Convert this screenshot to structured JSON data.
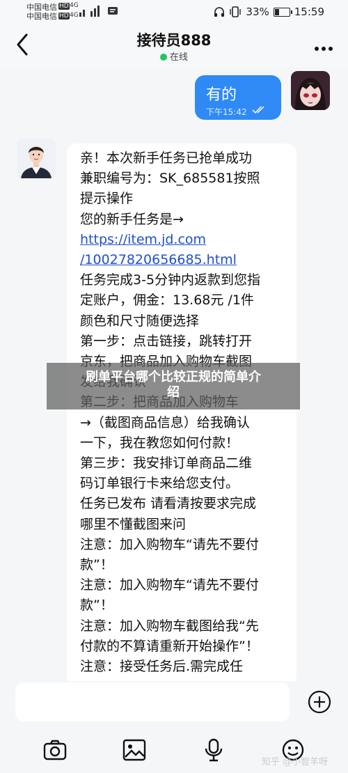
{
  "status_bar": {
    "carrier_1": "中国电信",
    "carrier_2": "中国电信",
    "sim_1_badge": "HD",
    "sim_2_badge": "HD",
    "net_1": "4G",
    "net_2": "4G",
    "battery_text": "33%",
    "battery_level": 0.33,
    "time": "15:59"
  },
  "header": {
    "title": "接待员888",
    "status": "在线",
    "status_color": "#22c55e"
  },
  "messages": {
    "outgoing": {
      "text": "有的",
      "time": "下午15:42"
    },
    "incoming": {
      "lines": [
        "亲！本次新手任务已抢单成功",
        "兼职编号为：SK_685581按照",
        "提示操作",
        "您的新手任务是→",
        "https://item.jd.com",
        "/10027820656685.html",
        "任务完成3-5分钟内返款到您指",
        "定账户，佣金：13.68元 /1件",
        "颜色和尺寸随便选择",
        "第一步：点击链接，跳转打开",
        "京东，把商品加入购物车截图",
        "发给我确认",
        "第二步：把商品加入购物车",
        "→（截图商品信息）给我确认",
        "一下，我在教您如何付款！",
        "第三步：我安排订单商品二维",
        "码订单银行卡来给您支付。",
        "任务已发布 请看清按要求完成",
        "哪里不懂截图来问",
        "注意：加入购物车“请先不要付",
        "款”！",
        "注意：加入购物车“请先不要付",
        "款”！",
        "注意：加入购物车截图给我“先",
        "付款的不算请重新开始操作”！",
        "注意：接受任务后.需完成任"
      ]
    }
  },
  "overlay": {
    "line_1": "刷单平台哪个比较正规的简单介",
    "line_2": "绍"
  },
  "toolbar": {
    "icons": [
      "camera-icon",
      "image-icon",
      "microphone-icon",
      "emoji-icon"
    ],
    "plus_icon": "plus-circle-icon"
  },
  "watermark": "知乎 @小智羊呀",
  "colors": {
    "accent_blue": "#2f8af5",
    "link": "#1f4fd1"
  }
}
